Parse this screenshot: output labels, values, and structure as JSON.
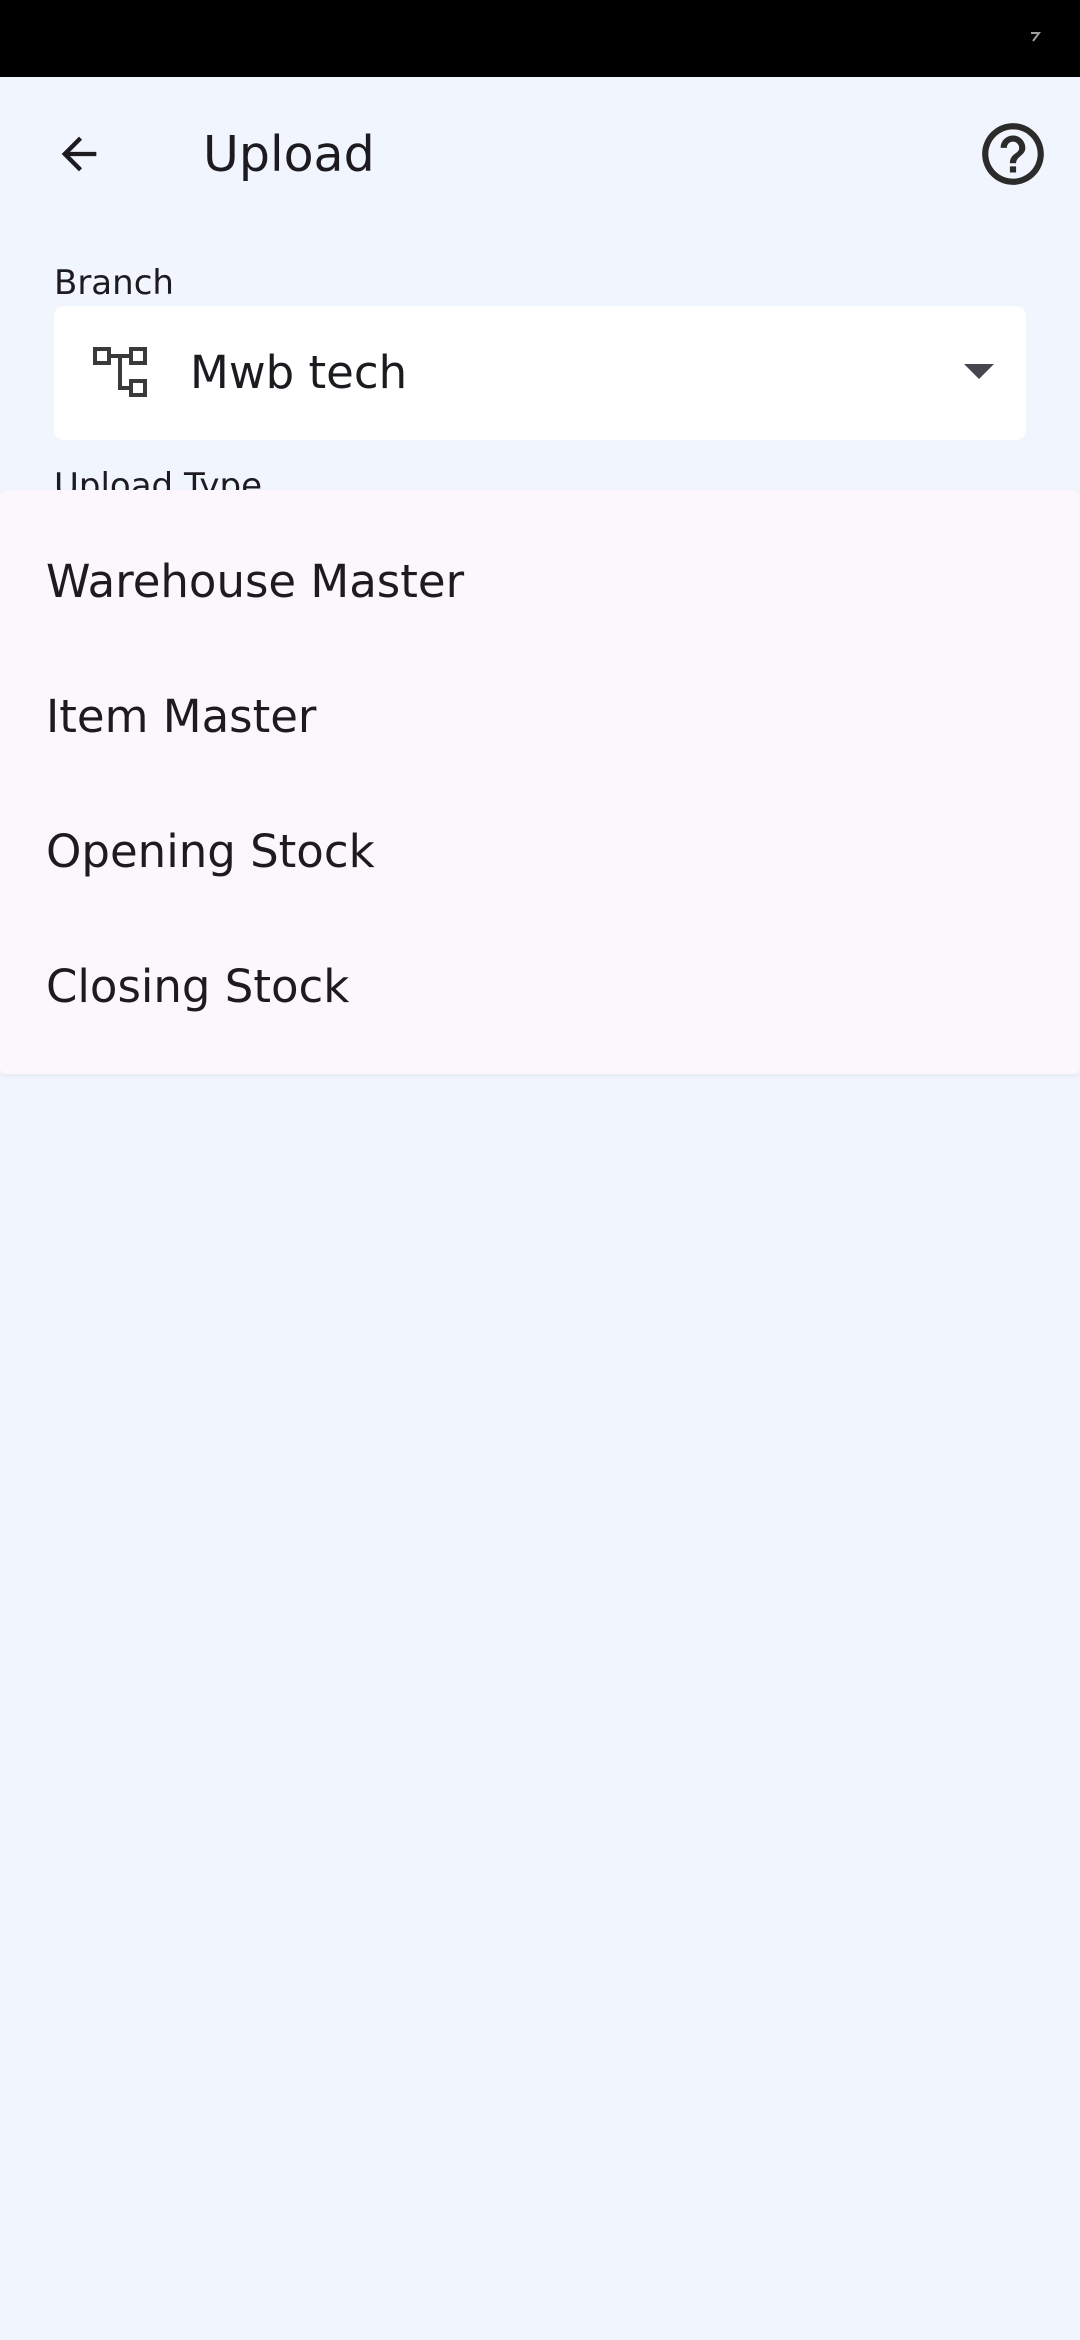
{
  "app_bar": {
    "title": "Upload",
    "back_icon": "arrow-back-icon",
    "help_icon": "help-circle-icon"
  },
  "form": {
    "branch_label": "Branch",
    "branch_value": "Mwb tech",
    "branch_icon": "account-tree-icon",
    "upload_type_label": "Upload Type"
  },
  "menu": {
    "items": [
      {
        "label": "Warehouse Master"
      },
      {
        "label": "Item Master"
      },
      {
        "label": "Opening Stock"
      },
      {
        "label": "Closing Stock"
      }
    ]
  },
  "colors": {
    "background": "#f1f5fd",
    "menu_surface": "#fcf7fc",
    "text": "#1d1b20",
    "status_bar": "#000000"
  }
}
